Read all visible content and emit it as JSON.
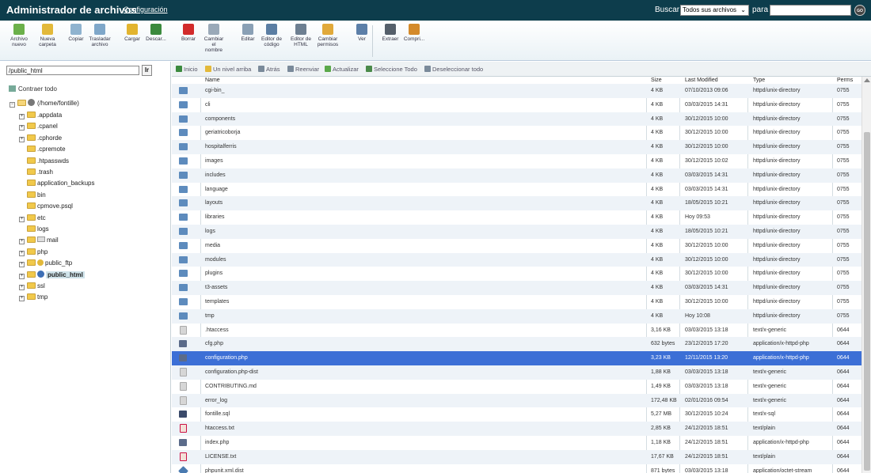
{
  "header": {
    "title": "Administrador de archivos",
    "config_link": "Configuración",
    "search_label": "Buscar",
    "search_scope": "Todos sus archivos",
    "para_label": "para",
    "go_label": "GO"
  },
  "toolbar": [
    {
      "label1": "Archivo",
      "label2": "nuevo",
      "icon": "new-file-icon",
      "color": "#6bb04a"
    },
    {
      "label1": "Nueva",
      "label2": "carpeta",
      "icon": "new-folder-icon",
      "color": "#e3b93a"
    },
    {
      "label1": "Copiar",
      "label2": "",
      "icon": "copy-icon",
      "color": "#8fb3cf"
    },
    {
      "label1": "Trasladar",
      "label2": "archivo",
      "icon": "move-icon",
      "color": "#7fa7c9"
    },
    {
      "label1": "Cargar",
      "label2": "",
      "icon": "upload-icon",
      "color": "#e2b42f"
    },
    {
      "label1": "Descar...",
      "label2": "",
      "icon": "download-icon",
      "color": "#3b8a3e"
    },
    {
      "label1": "Borrar",
      "label2": "",
      "icon": "delete-icon",
      "color": "#d22b2b"
    },
    {
      "label1": "Cambiar",
      "label2": "el",
      "label3": "nombre",
      "icon": "rename-icon",
      "color": "#9aa9b8"
    },
    {
      "label1": "Editar",
      "label2": "",
      "icon": "edit-icon",
      "color": "#8aa0b5"
    },
    {
      "label1": "Editor de",
      "label2": "código",
      "icon": "code-editor-icon",
      "color": "#5b7ea3"
    },
    {
      "label1": "Editor de",
      "label2": "HTML",
      "icon": "html-editor-icon",
      "color": "#6d7f91"
    },
    {
      "label1": "Cambiar",
      "label2": "permisos",
      "icon": "permissions-icon",
      "color": "#e1a93a"
    },
    {
      "label1": "Ver",
      "label2": "",
      "icon": "view-icon",
      "color": "#5c7fa8"
    },
    {
      "label1": "Extraer",
      "label2": "",
      "icon": "extract-icon",
      "color": "#555f6a"
    },
    {
      "label1": "Compri...",
      "label2": "",
      "icon": "compress-icon",
      "color": "#d48a2a"
    }
  ],
  "left": {
    "path": "/public_html",
    "go_label": "Ir",
    "collapse_all": "Contraer todo",
    "root": "(/home/fontille)",
    "tree": [
      {
        "name": ".appdata",
        "expandable": true
      },
      {
        "name": ".cpanel",
        "expandable": true
      },
      {
        "name": ".cphorde",
        "expandable": true
      },
      {
        "name": ".cpremote",
        "expandable": false
      },
      {
        "name": ".htpasswds",
        "expandable": false
      },
      {
        "name": ".trash",
        "expandable": false
      },
      {
        "name": "application_backups",
        "expandable": false
      },
      {
        "name": "bin",
        "expandable": false
      },
      {
        "name": "cpmove.psql",
        "expandable": false
      },
      {
        "name": "etc",
        "expandable": true
      },
      {
        "name": "logs",
        "expandable": false
      },
      {
        "name": "mail",
        "expandable": true
      },
      {
        "name": "php",
        "expandable": true
      },
      {
        "name": "public_ftp",
        "expandable": true
      },
      {
        "name": "public_html",
        "expandable": true,
        "selected": true
      },
      {
        "name": "ssl",
        "expandable": true
      },
      {
        "name": "tmp",
        "expandable": true
      }
    ]
  },
  "nav": [
    {
      "label": "Inicio",
      "icon": "home-icon",
      "color": "#3b8a3e"
    },
    {
      "label": "Un nivel arriba",
      "icon": "up-level-icon",
      "color": "#e3b93a"
    },
    {
      "label": "Atrás",
      "icon": "back-icon",
      "color": "#7a8a9a"
    },
    {
      "label": "Reenviar",
      "icon": "forward-icon",
      "color": "#7a8a9a"
    },
    {
      "label": "Actualizar",
      "icon": "refresh-icon",
      "color": "#5aa84a"
    },
    {
      "label": "Seleccione Todo",
      "icon": "select-all-icon",
      "color": "#4a8a4a"
    },
    {
      "label": "Deseleccionar todo",
      "icon": "deselect-all-icon",
      "color": "#7a8a9a"
    }
  ],
  "columns": {
    "name": "Name",
    "size": "Size",
    "modified": "Last Modified",
    "type": "Type",
    "perms": "Perms"
  },
  "files": [
    {
      "icon": "folder",
      "name": "cgi-bin_",
      "size": "4 KB",
      "modified": "07/10/2013 09:06",
      "type": "httpd/unix-directory",
      "perms": "0755"
    },
    {
      "icon": "folder",
      "name": "cli",
      "size": "4 KB",
      "modified": "03/03/2015 14:31",
      "type": "httpd/unix-directory",
      "perms": "0755"
    },
    {
      "icon": "folder",
      "name": "components",
      "size": "4 KB",
      "modified": "30/12/2015 10:00",
      "type": "httpd/unix-directory",
      "perms": "0755"
    },
    {
      "icon": "folder",
      "name": "geriatricoborja",
      "size": "4 KB",
      "modified": "30/12/2015 10:00",
      "type": "httpd/unix-directory",
      "perms": "0755"
    },
    {
      "icon": "folder",
      "name": "hospitalferris",
      "size": "4 KB",
      "modified": "30/12/2015 10:00",
      "type": "httpd/unix-directory",
      "perms": "0755"
    },
    {
      "icon": "folder",
      "name": "images",
      "size": "4 KB",
      "modified": "30/12/2015 10:02",
      "type": "httpd/unix-directory",
      "perms": "0755"
    },
    {
      "icon": "folder",
      "name": "includes",
      "size": "4 KB",
      "modified": "03/03/2015 14:31",
      "type": "httpd/unix-directory",
      "perms": "0755"
    },
    {
      "icon": "folder",
      "name": "language",
      "size": "4 KB",
      "modified": "03/03/2015 14:31",
      "type": "httpd/unix-directory",
      "perms": "0755"
    },
    {
      "icon": "folder",
      "name": "layouts",
      "size": "4 KB",
      "modified": "18/05/2015 10:21",
      "type": "httpd/unix-directory",
      "perms": "0755"
    },
    {
      "icon": "folder",
      "name": "libraries",
      "size": "4 KB",
      "modified": "Hoy 09:53",
      "type": "httpd/unix-directory",
      "perms": "0755"
    },
    {
      "icon": "folder",
      "name": "logs",
      "size": "4 KB",
      "modified": "18/05/2015 10:21",
      "type": "httpd/unix-directory",
      "perms": "0755"
    },
    {
      "icon": "folder",
      "name": "media",
      "size": "4 KB",
      "modified": "30/12/2015 10:00",
      "type": "httpd/unix-directory",
      "perms": "0755"
    },
    {
      "icon": "folder",
      "name": "modules",
      "size": "4 KB",
      "modified": "30/12/2015 10:00",
      "type": "httpd/unix-directory",
      "perms": "0755"
    },
    {
      "icon": "folder",
      "name": "plugins",
      "size": "4 KB",
      "modified": "30/12/2015 10:00",
      "type": "httpd/unix-directory",
      "perms": "0755"
    },
    {
      "icon": "folder",
      "name": "t3-assets",
      "size": "4 KB",
      "modified": "03/03/2015 14:31",
      "type": "httpd/unix-directory",
      "perms": "0755"
    },
    {
      "icon": "folder",
      "name": "templates",
      "size": "4 KB",
      "modified": "30/12/2015 10:00",
      "type": "httpd/unix-directory",
      "perms": "0755"
    },
    {
      "icon": "folder",
      "name": "tmp",
      "size": "4 KB",
      "modified": "Hoy 10:08",
      "type": "httpd/unix-directory",
      "perms": "0755"
    },
    {
      "icon": "doc",
      "name": ".htaccess",
      "size": "3,16 KB",
      "modified": "03/03/2015 13:18",
      "type": "text/x-generic",
      "perms": "0644"
    },
    {
      "icon": "php",
      "name": "cfg.php",
      "size": "632 bytes",
      "modified": "23/12/2015 17:20",
      "type": "application/x-httpd-php",
      "perms": "0644"
    },
    {
      "icon": "php",
      "name": "configuration.php",
      "size": "3,23 KB",
      "modified": "12/11/2015 13:20",
      "type": "application/x-httpd-php",
      "perms": "0644",
      "selected": true
    },
    {
      "icon": "doc",
      "name": "configuration.php-dist",
      "size": "1,88 KB",
      "modified": "03/03/2015 13:18",
      "type": "text/x-generic",
      "perms": "0644"
    },
    {
      "icon": "doc",
      "name": "CONTRIBUTING.md",
      "size": "1,49 KB",
      "modified": "03/03/2015 13:18",
      "type": "text/x-generic",
      "perms": "0644"
    },
    {
      "icon": "doc",
      "name": "error_log",
      "size": "172,48 KB",
      "modified": "02/01/2016 09:54",
      "type": "text/x-generic",
      "perms": "0644"
    },
    {
      "icon": "sql",
      "name": "fontille.sql",
      "size": "5,27 MB",
      "modified": "30/12/2015 10:24",
      "type": "text/x-sql",
      "perms": "0644"
    },
    {
      "icon": "txt",
      "name": "htaccess.txt",
      "size": "2,85 KB",
      "modified": "24/12/2015 18:51",
      "type": "text/plain",
      "perms": "0644"
    },
    {
      "icon": "php",
      "name": "index.php",
      "size": "1,18 KB",
      "modified": "24/12/2015 18:51",
      "type": "application/x-httpd-php",
      "perms": "0644"
    },
    {
      "icon": "txt",
      "name": "LICENSE.txt",
      "size": "17,67 KB",
      "modified": "24/12/2015 18:51",
      "type": "text/plain",
      "perms": "0644"
    },
    {
      "icon": "xml",
      "name": "phpunit.xml.dist",
      "size": "871 bytes",
      "modified": "03/03/2015 13:18",
      "type": "application/octet-stream",
      "perms": "0644"
    }
  ]
}
